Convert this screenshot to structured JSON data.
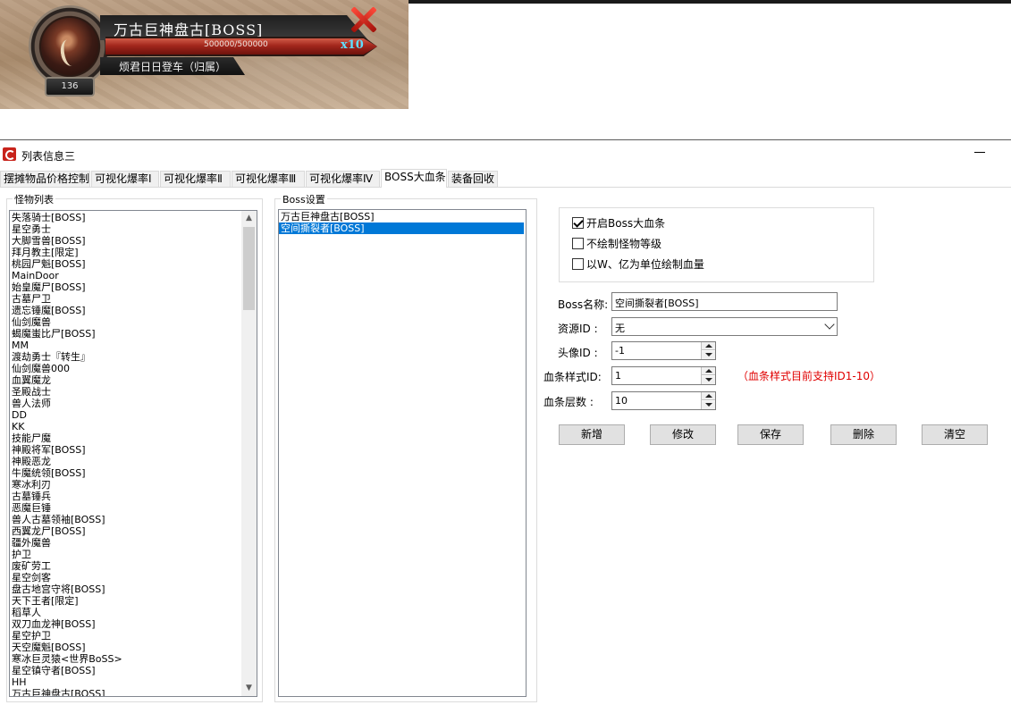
{
  "banner": {
    "boss_name": "万古巨神盘古[BOSS]",
    "hp_text": "500000/500000",
    "hp_fraction": 1.0,
    "hp_multiplier": "x10",
    "owner": "烦君日日登车（归属）",
    "level": "136"
  },
  "window": {
    "title": "列表信息三",
    "minimize_label": "—"
  },
  "tabs": [
    {
      "label": "摆摊物品价格控制",
      "active": false
    },
    {
      "label": "可视化爆率Ⅰ",
      "active": false
    },
    {
      "label": "可视化爆率Ⅱ",
      "active": false
    },
    {
      "label": "可视化爆率Ⅲ",
      "active": false
    },
    {
      "label": "可视化爆率Ⅳ",
      "active": false
    },
    {
      "label": "BOSS大血条",
      "active": true
    },
    {
      "label": "装备回收",
      "active": false
    }
  ],
  "monster_list": {
    "label": "怪物列表",
    "items": [
      "失落骑士[BOSS]",
      "星空勇士",
      "大脚雪兽[BOSS]",
      "拜月教主[限定]",
      "桃园尸魁[BOSS]",
      "MainDoor",
      "始皇魔尸[BOSS]",
      "古墓尸卫",
      "遗忘锤魔[BOSS]",
      "仙剑魔兽",
      "蝎魔蚩比尸[BOSS]",
      "MM",
      "渡劫勇士『转生』",
      "仙剑魔兽000",
      "血翼魔龙",
      "圣殿战士",
      "兽人法师",
      "DD",
      "KK",
      "技能尸魔",
      "神殿将军[BOSS]",
      "神殿恶龙",
      "牛魔统领[BOSS]",
      "寒冰利刃",
      "古墓锤兵",
      "恶魔巨锤",
      "兽人古墓领袖[BOSS]",
      "西翼龙尸[BOSS]",
      "疆外魔兽",
      "护卫",
      "废矿劳工",
      "星空剑客",
      "盘古地宫守将[BOSS]",
      "天下王者[限定]",
      "稻草人",
      "双刀血龙神[BOSS]",
      "星空护卫",
      "天空魔魁[BOSS]",
      "寒冰巨灵猿<世界BoSS>",
      "星空镇守者[BOSS]",
      "HH",
      "万古巨神盘古[BOSS]"
    ]
  },
  "boss_settings": {
    "label": "Boss设置",
    "items": [
      "万古巨神盘古[BOSS]",
      "空间撕裂者[BOSS]"
    ],
    "selected_index": 1
  },
  "options": {
    "enable_boss_bar": {
      "label": "开启Boss大血条",
      "checked": true
    },
    "no_monster_level": {
      "label": "不绘制怪物等级",
      "checked": false
    },
    "wan_yi_units": {
      "label": "以W、亿为单位绘制血量",
      "checked": false
    }
  },
  "form": {
    "boss_name_label": "Boss名称:",
    "boss_name_value": "空间撕裂者[BOSS]",
    "resource_id_label": "资源ID  :",
    "resource_id_value": "无",
    "avatar_id_label": "头像ID  :",
    "avatar_id_value": "-1",
    "bar_style_label": "血条样式ID:",
    "bar_style_value": "1",
    "bar_layers_label": "血条层数 :",
    "bar_layers_value": "10",
    "hint": "（血条样式目前支持ID1-10）"
  },
  "buttons": {
    "add": "新增",
    "edit": "修改",
    "save": "保存",
    "delete": "删除",
    "clear": "清空"
  },
  "colors": {
    "selection": "#0078d7",
    "hint_red": "#e00000",
    "hp_red": "#a2261c",
    "multiplier_cyan": "#5fe0ff"
  }
}
